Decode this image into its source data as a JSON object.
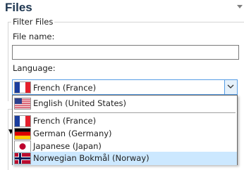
{
  "panel": {
    "title": "Files"
  },
  "filter": {
    "group_label": "Filter Files",
    "file_name_label": "File name:",
    "file_name_value": "",
    "language_label": "Language:",
    "language_selected": {
      "label": "French (France)",
      "flag": "flag-france-icon"
    }
  },
  "language_options": [
    {
      "label": "English (United States)",
      "flag": "flag-usa-icon"
    },
    {
      "label": "French (France)",
      "flag": "flag-france-icon"
    },
    {
      "label": "German (Germany)",
      "flag": "flag-germany-icon"
    },
    {
      "label": "Japanese (Japan)",
      "flag": "flag-japan-icon"
    },
    {
      "label": "Norwegian Bokmål (Norway)",
      "flag": "flag-norway-icon",
      "highlighted": true
    }
  ],
  "colors": {
    "title": "#1e3650",
    "focus_border": "#569de5",
    "highlight": "#cce8ff"
  }
}
